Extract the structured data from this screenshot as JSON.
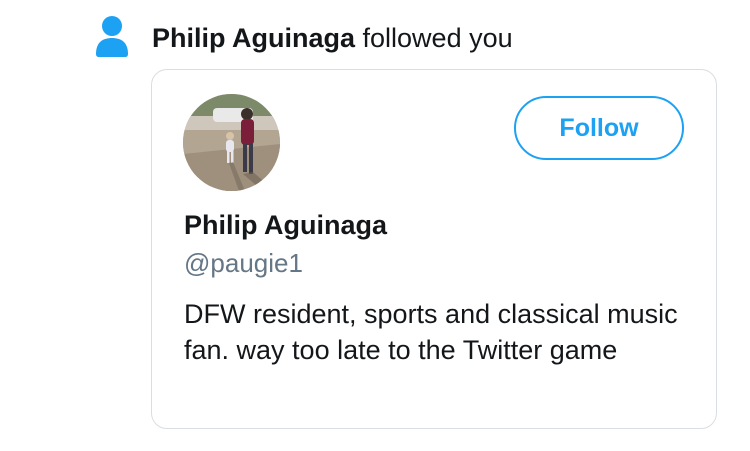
{
  "notification": {
    "icon": "person-icon",
    "name": "Philip Aguinaga",
    "action": "followed you",
    "icon_color": "#1da1f2"
  },
  "profile_card": {
    "avatar_icon": "profile-photo",
    "follow_label": "Follow",
    "display_name": "Philip Aguinaga",
    "handle": "@paugie1",
    "bio": "DFW resident, sports and classical music fan. way too late to the Twitter game",
    "accent_color": "#1da1f2",
    "handle_color": "#657786",
    "border_color": "#d8dee3"
  }
}
